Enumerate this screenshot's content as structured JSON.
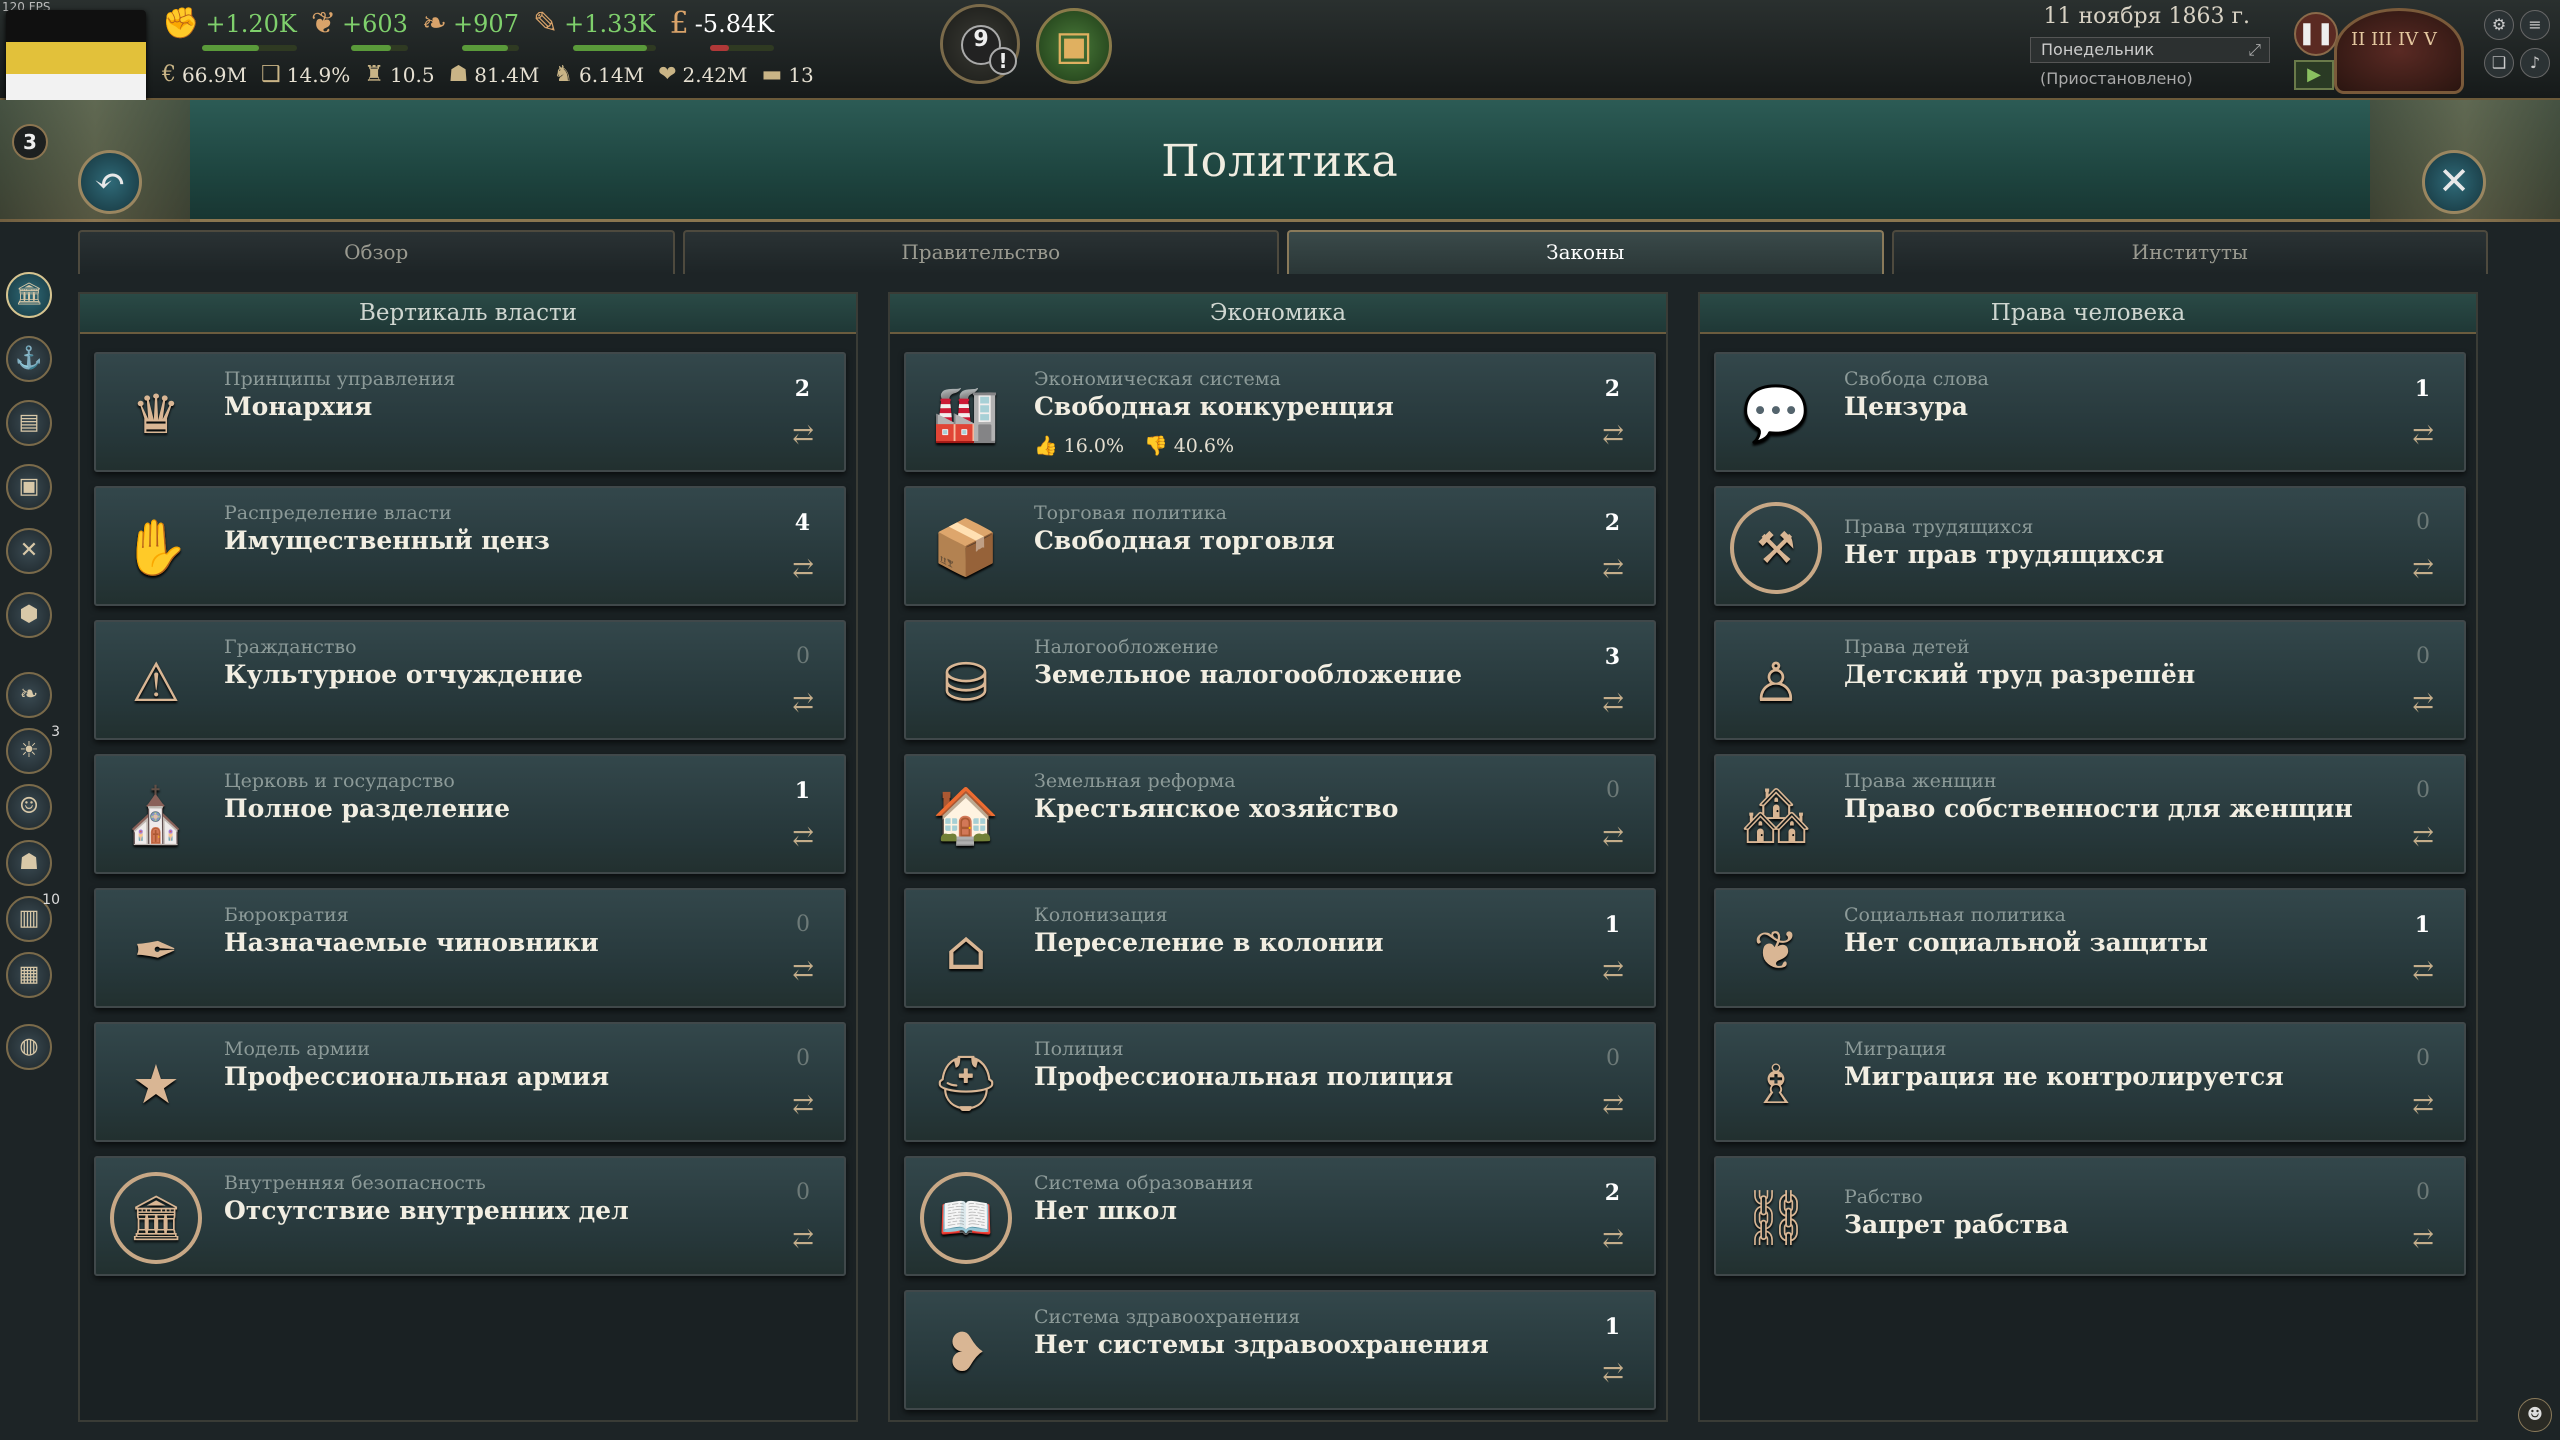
{
  "fps": "120 FPS",
  "top_stats": [
    {
      "icon": "legitimacy-icon",
      "glyph": "✊",
      "value": "+1.20K",
      "tone": "pos",
      "bar": 0.6
    },
    {
      "icon": "influence-icon",
      "glyph": "❦",
      "value": "+603",
      "tone": "pos",
      "bar": 0.7
    },
    {
      "icon": "bureaucracy-icon",
      "glyph": "❧",
      "value": "+907",
      "tone": "pos",
      "bar": 0.8
    },
    {
      "icon": "authority-icon",
      "glyph": "✎",
      "value": "+1.33K",
      "tone": "pos",
      "bar": 0.9
    },
    {
      "icon": "treasury-icon",
      "glyph": "£",
      "value": "-5.84K",
      "tone": "neg",
      "bar": 0.3
    }
  ],
  "second_stats": [
    {
      "icon": "gdp-icon",
      "glyph": "€",
      "value": "66.9M"
    },
    {
      "icon": "literacy-icon",
      "glyph": "❑",
      "value": "14.9%"
    },
    {
      "icon": "standard-of-living-icon",
      "glyph": "♜",
      "value": "10.5"
    },
    {
      "icon": "population-icon",
      "glyph": "☗",
      "value": "81.4M"
    },
    {
      "icon": "army-icon",
      "glyph": "♞",
      "value": "6.14M"
    },
    {
      "icon": "radicals-icon",
      "glyph": "❤",
      "value": "2.42M"
    },
    {
      "icon": "navy-icon",
      "glyph": "▬",
      "value": "13"
    }
  ],
  "flag_badge": "3",
  "journal": {
    "count": "9",
    "alert": "!"
  },
  "date": {
    "text": "11 ноября 1863 г.",
    "weekday": "Понедельник",
    "status": "(Приостановлено)"
  },
  "clock_numerals": "II  III  IV  V",
  "title": "Политика",
  "tabs": [
    {
      "label": "Обзор",
      "active": false
    },
    {
      "label": "Правительство",
      "active": false
    },
    {
      "label": "Законы",
      "active": true
    },
    {
      "label": "Институты",
      "active": false
    }
  ],
  "sidebar_badges": {
    "ideas": "3",
    "market": "10"
  },
  "columns": [
    {
      "title": "Вертикаль власти",
      "laws": [
        {
          "category": "Принципы управления",
          "law": "Монархия",
          "count": "2",
          "icon": "crown-icon",
          "glyph": "♛"
        },
        {
          "category": "Распределение власти",
          "law": "Имущественный ценз",
          "count": "4",
          "icon": "raised-hands-icon",
          "glyph": "✋"
        },
        {
          "category": "Гражданство",
          "law": "Культурное отчуждение",
          "count": "0",
          "icon": "warning-hand-icon",
          "glyph": "⚠"
        },
        {
          "category": "Церковь и государство",
          "law": "Полное разделение",
          "count": "1",
          "icon": "church-state-icon",
          "glyph": "⛪"
        },
        {
          "category": "Бюрократия",
          "law": "Назначаемые чиновники",
          "count": "0",
          "icon": "quill-hand-icon",
          "glyph": "✒"
        },
        {
          "category": "Модель армии",
          "law": "Профессиональная армия",
          "count": "0",
          "icon": "medal-star-icon",
          "glyph": "★"
        },
        {
          "category": "Внутренняя безопасность",
          "law": "Отсутствие внутренних дел",
          "count": "0",
          "icon": "no-ministry-icon",
          "glyph": "🏛",
          "ring": true
        }
      ]
    },
    {
      "title": "Экономика",
      "laws": [
        {
          "category": "Экономическая система",
          "law": "Свободная конкуренция",
          "count": "2",
          "icon": "factory-growth-icon",
          "glyph": "🏭",
          "support": "16.0%",
          "oppose": "40.6%"
        },
        {
          "category": "Торговая политика",
          "law": "Свободная торговля",
          "count": "2",
          "icon": "crates-icon",
          "glyph": "📦"
        },
        {
          "category": "Налогообложение",
          "law": "Земельное налогообложение",
          "count": "3",
          "icon": "coins-icon",
          "glyph": "⛁"
        },
        {
          "category": "Земельная реформа",
          "law": "Крестьянское хозяйство",
          "count": "0",
          "icon": "homestead-icon",
          "glyph": "🏠"
        },
        {
          "category": "Колонизация",
          "law": "Переселение в колонии",
          "count": "1",
          "icon": "colony-house-icon",
          "glyph": "⌂"
        },
        {
          "category": "Полиция",
          "law": "Профессиональная полиция",
          "count": "0",
          "icon": "police-helmet-icon",
          "glyph": "⛑"
        },
        {
          "category": "Система образования",
          "law": "Нет школ",
          "count": "2",
          "icon": "no-book-icon",
          "glyph": "📖",
          "ring": true
        },
        {
          "category": "Система здравоохранения",
          "law": "Нет системы здравоохранения",
          "count": "1",
          "icon": "broken-heart-icon",
          "glyph": "❥"
        }
      ]
    },
    {
      "title": "Права человека",
      "laws": [
        {
          "category": "Свобода слова",
          "law": "Цензура",
          "count": "1",
          "icon": "speech-bubble-icon",
          "glyph": "💬"
        },
        {
          "category": "Права трудящихся",
          "law": "Нет прав трудящихся",
          "count": "0",
          "icon": "no-workers-icon",
          "glyph": "⚒",
          "ring": true,
          "mid": true
        },
        {
          "category": "Права детей",
          "law": "Детский труд разрешён",
          "count": "0",
          "icon": "child-worker-icon",
          "glyph": "♙"
        },
        {
          "category": "Права женщин",
          "law": "Право собственности для женщин",
          "count": "0",
          "icon": "house-property-icon",
          "glyph": "🏘"
        },
        {
          "category": "Социальная политика",
          "law": "Нет социальной защиты",
          "count": "1",
          "icon": "wings-icon",
          "glyph": "❦"
        },
        {
          "category": "Миграция",
          "law": "Миграция не контролируется",
          "count": "0",
          "icon": "migrant-icon",
          "glyph": "♗"
        },
        {
          "category": "Рабство",
          "law": "Запрет рабства",
          "count": "0",
          "icon": "broken-chain-icon",
          "glyph": "⛓",
          "mid": true
        }
      ]
    }
  ]
}
